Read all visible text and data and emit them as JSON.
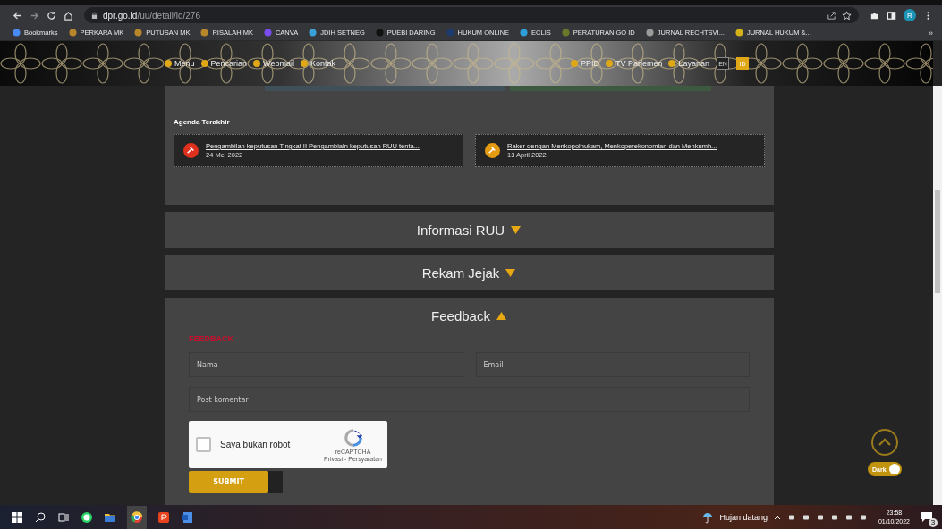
{
  "browser": {
    "url_host": "dpr.go.id",
    "url_path": "/uu/detail/id/276",
    "profile": "R",
    "overflow": "»",
    "bookmarks": [
      {
        "label": "Bookmarks",
        "color": "#4a8af4"
      },
      {
        "label": "PERKARA MK",
        "color": "#b8862b"
      },
      {
        "label": "PUTUSAN MK",
        "color": "#b8862b"
      },
      {
        "label": "RISALAH MK",
        "color": "#b8862b"
      },
      {
        "label": "CANVA",
        "color": "#7a4df0"
      },
      {
        "label": "JDIH SETNEG",
        "color": "#3aa0d8"
      },
      {
        "label": "PUEBI DARING",
        "color": "#111111"
      },
      {
        "label": "HUKUM ONLINE",
        "color": "#1d3c6e"
      },
      {
        "label": "ECLIS",
        "color": "#2f9fd8"
      },
      {
        "label": "PERATURAN GO ID",
        "color": "#6a7a2a"
      },
      {
        "label": "JURNAL RECHTSVI...",
        "color": "#9a9a9a"
      },
      {
        "label": "JURNAL HUKUM &...",
        "color": "#d4b21a"
      }
    ]
  },
  "nav": {
    "left_items": [
      {
        "label": "Menu"
      },
      {
        "label": "Pencarian"
      },
      {
        "label": "Webmail"
      },
      {
        "label": "Kontak"
      }
    ],
    "right_items": [
      {
        "label": "PPID"
      },
      {
        "label": "TV Parlemen"
      },
      {
        "label": "Layanan"
      }
    ],
    "languages": [
      {
        "label": "EN",
        "selected": false
      },
      {
        "label": "ID",
        "selected": true
      }
    ]
  },
  "agenda": {
    "title": "Agenda Terakhir",
    "items": [
      {
        "title": "Pengambilan keputusan Tingkat II Pengambialn keputusan RUU tenta...",
        "date": "24 Mei 2022",
        "color": "#e0301e"
      },
      {
        "title": "Raker dengan Menkopolhukam, Menkoperekonomian dan Menkumh...",
        "date": "13 April 2022",
        "color": "#e59b10"
      }
    ]
  },
  "accordions": [
    {
      "title": "Informasi RUU",
      "expanded": false
    },
    {
      "title": "Rekam Jejak",
      "expanded": false
    },
    {
      "title": "Feedback",
      "expanded": true
    }
  ],
  "feedback": {
    "heading": "FEEDBACK",
    "name_placeholder": "Nama",
    "email_placeholder": "Email",
    "comment_placeholder": "Post komentar",
    "captcha": {
      "label": "Saya bukan robot",
      "checked": false,
      "brand": "reCAPTCHA",
      "links": "Privasi - Persyaratan"
    },
    "submit": "SUBMIT"
  },
  "dark_mode": {
    "label": "Dark",
    "on": true
  },
  "taskbar": {
    "weather": "Hujan datang",
    "time": "23:58",
    "date": "01/10/2022",
    "notifications": "3"
  }
}
